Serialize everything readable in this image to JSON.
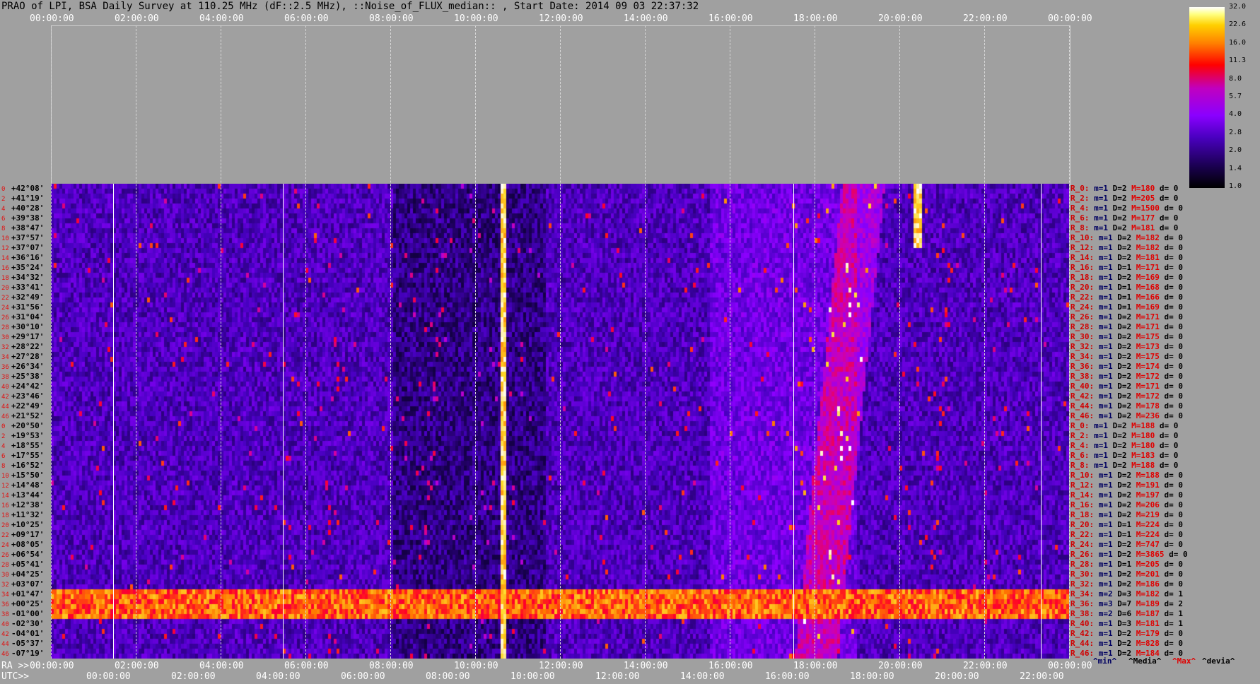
{
  "title": "PRAO of LPI, BSA Daily Survey at 110.25 MHz (dF::2.5 MHz), ::Noise_of_FLUX_median:: , Start Date: 2014 09 03 22:37:32",
  "top_ticks": [
    "00:00:00",
    "02:00:00",
    "04:00:00",
    "06:00:00",
    "08:00:00",
    "10:00:00",
    "12:00:00",
    "14:00:00",
    "16:00:00",
    "18:00:00",
    "20:00:00",
    "22:00:00",
    "00:00:00"
  ],
  "colorbar_ticks": [
    "32.0",
    "22.6",
    "16.0",
    "11.3",
    "8.0",
    "5.7",
    "4.0",
    "2.8",
    "2.0",
    "1.4",
    "1.0"
  ],
  "declinations": [
    {
      "i": "0",
      "d": "+42°08'"
    },
    {
      "i": "2",
      "d": "+41°19'"
    },
    {
      "i": "4",
      "d": "+40°28'"
    },
    {
      "i": "6",
      "d": "+39°38'"
    },
    {
      "i": "8",
      "d": "+38°47'"
    },
    {
      "i": "10",
      "d": "+37°57'"
    },
    {
      "i": "12",
      "d": "+37°07'"
    },
    {
      "i": "14",
      "d": "+36°16'"
    },
    {
      "i": "16",
      "d": "+35°24'"
    },
    {
      "i": "18",
      "d": "+34°32'"
    },
    {
      "i": "20",
      "d": "+33°41'"
    },
    {
      "i": "22",
      "d": "+32°49'"
    },
    {
      "i": "24",
      "d": "+31°56'"
    },
    {
      "i": "26",
      "d": "+31°04'"
    },
    {
      "i": "28",
      "d": "+30°10'"
    },
    {
      "i": "30",
      "d": "+29°17'"
    },
    {
      "i": "32",
      "d": "+28°22'"
    },
    {
      "i": "34",
      "d": "+27°28'"
    },
    {
      "i": "36",
      "d": "+26°34'"
    },
    {
      "i": "38",
      "d": "+25°38'"
    },
    {
      "i": "40",
      "d": "+24°42'"
    },
    {
      "i": "42",
      "d": "+23°46'"
    },
    {
      "i": "44",
      "d": "+22°49'"
    },
    {
      "i": "46",
      "d": "+21°52'"
    },
    {
      "i": "0",
      "d": "+20°50'"
    },
    {
      "i": "2",
      "d": "+19°53'"
    },
    {
      "i": "4",
      "d": "+18°55'"
    },
    {
      "i": "6",
      "d": "+17°55'"
    },
    {
      "i": "8",
      "d": "+16°52'"
    },
    {
      "i": "10",
      "d": "+15°50'"
    },
    {
      "i": "12",
      "d": "+14°48'"
    },
    {
      "i": "14",
      "d": "+13°44'"
    },
    {
      "i": "16",
      "d": "+12°38'"
    },
    {
      "i": "18",
      "d": "+11°32'"
    },
    {
      "i": "20",
      "d": "+10°25'"
    },
    {
      "i": "22",
      "d": "+09°17'"
    },
    {
      "i": "24",
      "d": "+08°05'"
    },
    {
      "i": "26",
      "d": "+06°54'"
    },
    {
      "i": "28",
      "d": "+05°41'"
    },
    {
      "i": "30",
      "d": "+04°25'"
    },
    {
      "i": "32",
      "d": "+03°07'"
    },
    {
      "i": "34",
      "d": "+01°47'"
    },
    {
      "i": "36",
      "d": "+00°25'"
    },
    {
      "i": "38",
      "d": "-01°00'"
    },
    {
      "i": "40",
      "d": "-02°30'"
    },
    {
      "i": "42",
      "d": "-04°01'"
    },
    {
      "i": "44",
      "d": "-05°37'"
    },
    {
      "i": "46",
      "d": "-07°19'"
    }
  ],
  "row_stats": [
    {
      "r": "R_0:",
      "m": "m=1",
      "D": "D=2",
      "M": "M=180",
      "d": "d= 0"
    },
    {
      "r": "R_2:",
      "m": "m=1",
      "D": "D=2",
      "M": "M=205",
      "d": "d= 0"
    },
    {
      "r": "R_4:",
      "m": "m=1",
      "D": "D=2",
      "M": "M=1500",
      "d": "d= 0"
    },
    {
      "r": "R_6:",
      "m": "m=1",
      "D": "D=2",
      "M": "M=177",
      "d": "d= 0"
    },
    {
      "r": "R_8:",
      "m": "m=1",
      "D": "D=2",
      "M": "M=181",
      "d": "d= 0"
    },
    {
      "r": "R_10:",
      "m": "m=1",
      "D": "D=2",
      "M": "M=182",
      "d": "d= 0"
    },
    {
      "r": "R_12:",
      "m": "m=1",
      "D": "D=2",
      "M": "M=182",
      "d": "d= 0"
    },
    {
      "r": "R_14:",
      "m": "m=1",
      "D": "D=2",
      "M": "M=181",
      "d": "d= 0"
    },
    {
      "r": "R_16:",
      "m": "m=1",
      "D": "D=1",
      "M": "M=171",
      "d": "d= 0"
    },
    {
      "r": "R_18:",
      "m": "m=1",
      "D": "D=2",
      "M": "M=169",
      "d": "d= 0"
    },
    {
      "r": "R_20:",
      "m": "m=1",
      "D": "D=1",
      "M": "M=168",
      "d": "d= 0"
    },
    {
      "r": "R_22:",
      "m": "m=1",
      "D": "D=1",
      "M": "M=166",
      "d": "d= 0"
    },
    {
      "r": "R_24:",
      "m": "m=1",
      "D": "D=1",
      "M": "M=169",
      "d": "d= 0"
    },
    {
      "r": "R_26:",
      "m": "m=1",
      "D": "D=2",
      "M": "M=171",
      "d": "d= 0"
    },
    {
      "r": "R_28:",
      "m": "m=1",
      "D": "D=2",
      "M": "M=171",
      "d": "d= 0"
    },
    {
      "r": "R_30:",
      "m": "m=1",
      "D": "D=2",
      "M": "M=175",
      "d": "d= 0"
    },
    {
      "r": "R_32:",
      "m": "m=1",
      "D": "D=2",
      "M": "M=173",
      "d": "d= 0"
    },
    {
      "r": "R_34:",
      "m": "m=1",
      "D": "D=2",
      "M": "M=175",
      "d": "d= 0"
    },
    {
      "r": "R_36:",
      "m": "m=1",
      "D": "D=2",
      "M": "M=174",
      "d": "d= 0"
    },
    {
      "r": "R_38:",
      "m": "m=1",
      "D": "D=2",
      "M": "M=172",
      "d": "d= 0"
    },
    {
      "r": "R_40:",
      "m": "m=1",
      "D": "D=2",
      "M": "M=171",
      "d": "d= 0"
    },
    {
      "r": "R_42:",
      "m": "m=1",
      "D": "D=2",
      "M": "M=172",
      "d": "d= 0"
    },
    {
      "r": "R_44:",
      "m": "m=1",
      "D": "D=2",
      "M": "M=178",
      "d": "d= 0"
    },
    {
      "r": "R_46:",
      "m": "m=1",
      "D": "D=2",
      "M": "M=236",
      "d": "d= 0"
    },
    {
      "r": "R_0:",
      "m": "m=1",
      "D": "D=2",
      "M": "M=188",
      "d": "d= 0"
    },
    {
      "r": "R_2:",
      "m": "m=1",
      "D": "D=2",
      "M": "M=180",
      "d": "d= 0"
    },
    {
      "r": "R_4:",
      "m": "m=1",
      "D": "D=2",
      "M": "M=180",
      "d": "d= 0"
    },
    {
      "r": "R_6:",
      "m": "m=1",
      "D": "D=2",
      "M": "M=183",
      "d": "d= 0"
    },
    {
      "r": "R_8:",
      "m": "m=1",
      "D": "D=2",
      "M": "M=188",
      "d": "d= 0"
    },
    {
      "r": "R_10:",
      "m": "m=1",
      "D": "D=2",
      "M": "M=188",
      "d": "d= 0"
    },
    {
      "r": "R_12:",
      "m": "m=1",
      "D": "D=2",
      "M": "M=191",
      "d": "d= 0"
    },
    {
      "r": "R_14:",
      "m": "m=1",
      "D": "D=2",
      "M": "M=197",
      "d": "d= 0"
    },
    {
      "r": "R_16:",
      "m": "m=1",
      "D": "D=2",
      "M": "M=206",
      "d": "d= 0"
    },
    {
      "r": "R_18:",
      "m": "m=1",
      "D": "D=2",
      "M": "M=219",
      "d": "d= 0"
    },
    {
      "r": "R_20:",
      "m": "m=1",
      "D": "D=1",
      "M": "M=224",
      "d": "d= 0"
    },
    {
      "r": "R_22:",
      "m": "m=1",
      "D": "D=1",
      "M": "M=224",
      "d": "d= 0"
    },
    {
      "r": "R_24:",
      "m": "m=1",
      "D": "D=2",
      "M": "M=747",
      "d": "d= 0"
    },
    {
      "r": "R_26:",
      "m": "m=1",
      "D": "D=2",
      "M": "M=3865",
      "d": "d= 0"
    },
    {
      "r": "R_28:",
      "m": "m=1",
      "D": "D=1",
      "M": "M=205",
      "d": "d= 0"
    },
    {
      "r": "R_30:",
      "m": "m=1",
      "D": "D=2",
      "M": "M=201",
      "d": "d= 0"
    },
    {
      "r": "R_32:",
      "m": "m=1",
      "D": "D=2",
      "M": "M=186",
      "d": "d= 0"
    },
    {
      "r": "R_34:",
      "m": "m=2",
      "D": "D=3",
      "M": "M=182",
      "d": "d= 1"
    },
    {
      "r": "R_36:",
      "m": "m=3",
      "D": "D=7",
      "M": "M=189",
      "d": "d= 2"
    },
    {
      "r": "R_38:",
      "m": "m=2",
      "D": "D=6",
      "M": "M=187",
      "d": "d= 1"
    },
    {
      "r": "R_40:",
      "m": "m=1",
      "D": "D=3",
      "M": "M=181",
      "d": "d= 1"
    },
    {
      "r": "R_42:",
      "m": "m=1",
      "D": "D=2",
      "M": "M=179",
      "d": "d= 0"
    },
    {
      "r": "R_44:",
      "m": "m=1",
      "D": "D=2",
      "M": "M=828",
      "d": "d= 0"
    },
    {
      "r": "R_46:",
      "m": "m=1",
      "D": "D=2",
      "M": "M=184",
      "d": "d= 0"
    }
  ],
  "ra_prefix": "RA >>",
  "ra_ticks": [
    "00:00:00",
    "02:00:00",
    "04:00:00",
    "06:00:00",
    "08:00:00",
    "10:00:00",
    "12:00:00",
    "14:00:00",
    "16:00:00",
    "18:00:00",
    "20:00:00",
    "22:00:00",
    "00:00:00"
  ],
  "utc_prefix": "UTC>>",
  "utc_ticks": [
    "00:00:00",
    "02:00:00",
    "04:00:00",
    "06:00:00",
    "08:00:00",
    "10:00:00",
    "12:00:00",
    "14:00:00",
    "16:00:00",
    "18:00:00",
    "20:00:00",
    "22:00:00"
  ],
  "legend": {
    "min": "^min^",
    "median": "^Media^",
    "max": "^Max^",
    "dev": "^devia^"
  },
  "colors": {
    "background": "#a0a0a0",
    "index_red": "#e01010",
    "max_red": "#e00000",
    "min_blue": "#000060"
  }
}
